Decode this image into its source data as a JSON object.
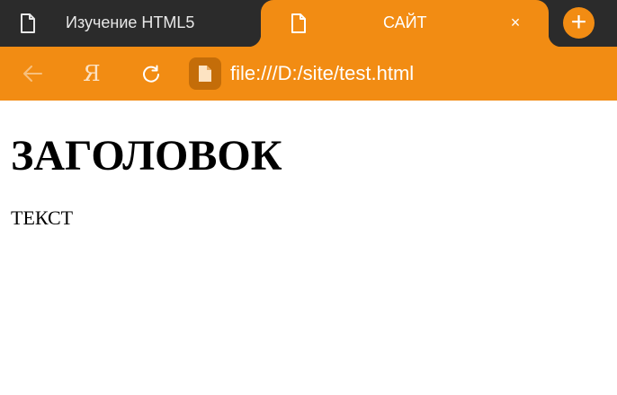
{
  "tabs": [
    {
      "label": "Изучение HTML5",
      "icon": "document-icon",
      "active": false
    },
    {
      "label": "САЙТ",
      "icon": "document-icon",
      "active": true
    }
  ],
  "tab_close_glyph": "×",
  "new_tab_glyph": "+",
  "toolbar": {
    "back_icon": "arrow-left-icon",
    "yandex_logo": "Я",
    "reload_icon": "reload-icon",
    "site_info_icon": "document-icon",
    "url": "file:///D:/site/test.html"
  },
  "page": {
    "heading": "ЗАГОЛОВОК",
    "text": "ТЕКСТ"
  },
  "colors": {
    "accent": "#f28c13",
    "tabstrip_bg": "#2b2b2b",
    "content_bg": "#ffffff"
  }
}
